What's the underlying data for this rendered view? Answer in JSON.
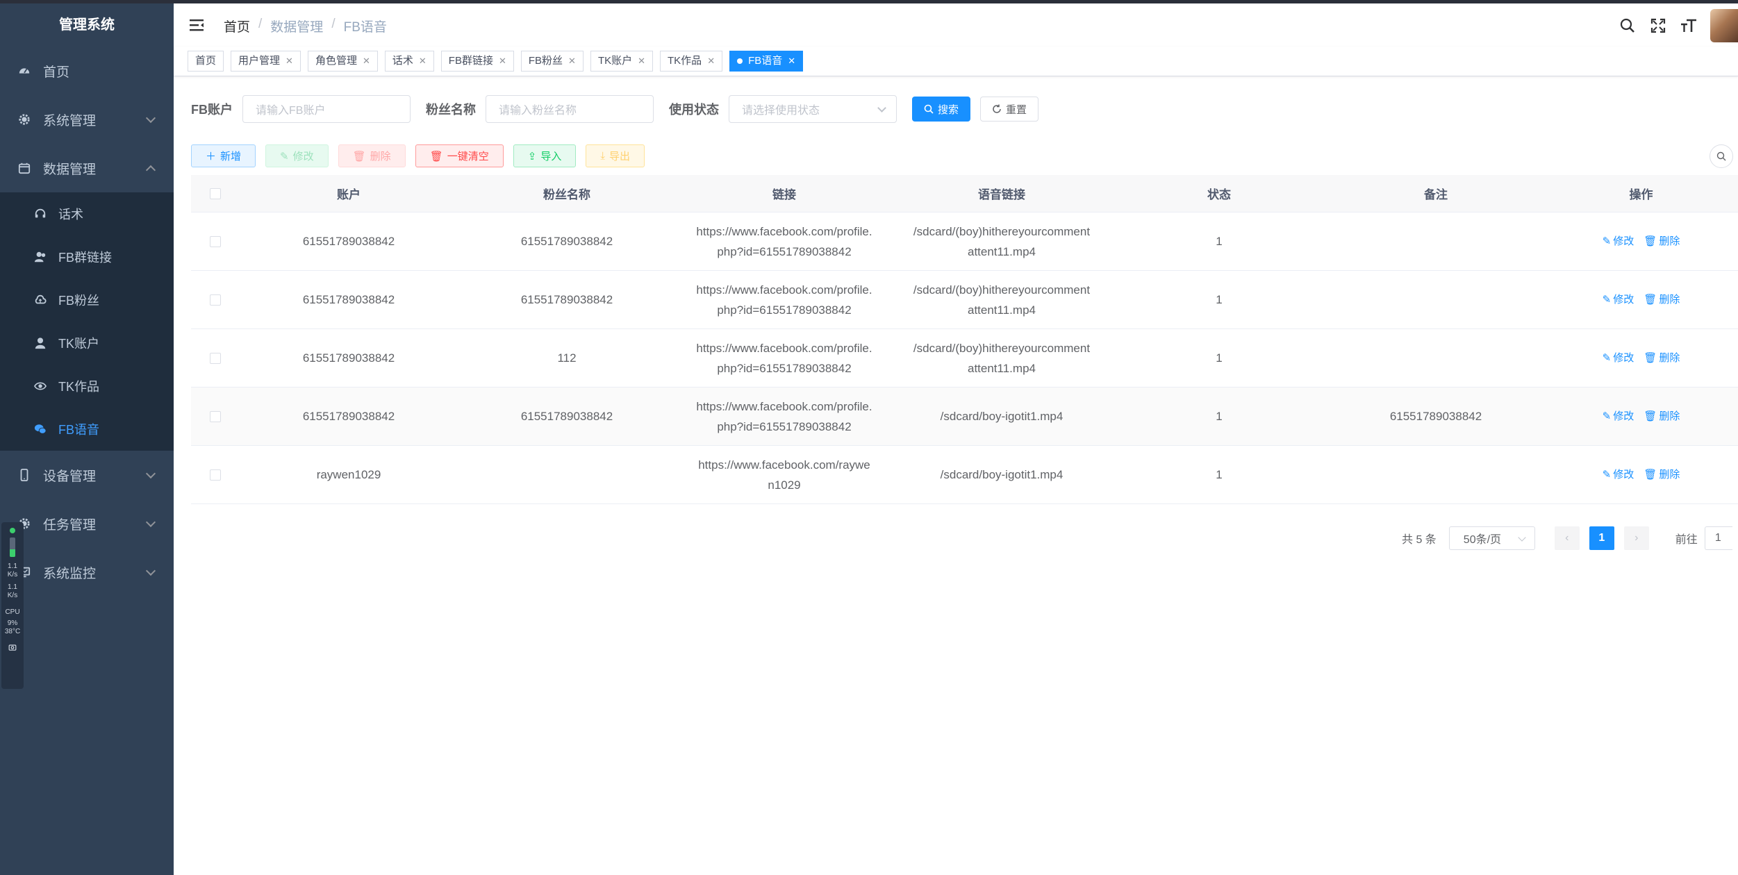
{
  "app": {
    "title": "管理系统"
  },
  "sidebar": {
    "items": [
      {
        "label": "首页",
        "icon": "dashboard-icon"
      },
      {
        "label": "系统管理",
        "icon": "gear-icon"
      },
      {
        "label": "数据管理",
        "icon": "calendar-icon",
        "expanded": true,
        "children": [
          {
            "label": "话术",
            "icon": "headset-icon"
          },
          {
            "label": "FB群链接",
            "icon": "peoples-icon"
          },
          {
            "label": "FB粉丝",
            "icon": "cloud-icon"
          },
          {
            "label": "TK账户",
            "icon": "user-icon"
          },
          {
            "label": "TK作品",
            "icon": "eye-icon"
          },
          {
            "label": "FB语音",
            "icon": "wechat-icon",
            "active": true
          }
        ]
      },
      {
        "label": "设备管理",
        "icon": "phone-icon"
      },
      {
        "label": "任务管理",
        "icon": "gear-icon"
      },
      {
        "label": "系统监控",
        "icon": "monitor-icon"
      }
    ]
  },
  "monitor": {
    "up": "1.1",
    "up_unit": "K/s",
    "down": "1.1",
    "down_unit": "K/s",
    "cpu_label": "CPU",
    "cpu": "9%",
    "temp": "38°C"
  },
  "breadcrumb": {
    "items": [
      "首页",
      "数据管理",
      "FB语音"
    ],
    "separator": "/"
  },
  "tabs": [
    {
      "label": "首页",
      "closable": false
    },
    {
      "label": "用户管理",
      "closable": true
    },
    {
      "label": "角色管理",
      "closable": true
    },
    {
      "label": "话术",
      "closable": true
    },
    {
      "label": "FB群链接",
      "closable": true
    },
    {
      "label": "FB粉丝",
      "closable": true
    },
    {
      "label": "TK账户",
      "closable": true
    },
    {
      "label": "TK作品",
      "closable": true
    },
    {
      "label": "FB语音",
      "closable": true,
      "active": true
    }
  ],
  "search": {
    "account_label": "FB账户",
    "account_placeholder": "请输入FB账户",
    "fan_label": "粉丝名称",
    "fan_placeholder": "请输入粉丝名称",
    "status_label": "使用状态",
    "status_placeholder": "请选择使用状态",
    "search_btn": "搜索",
    "reset_btn": "重置"
  },
  "toolbar": {
    "add": "新增",
    "edit": "修改",
    "delete": "删除",
    "clear": "一键清空",
    "import": "导入",
    "export": "导出"
  },
  "table": {
    "columns": [
      "账户",
      "粉丝名称",
      "链接",
      "语音链接",
      "状态",
      "备注",
      "操作"
    ],
    "rows": [
      {
        "account": "61551789038842",
        "fan": "61551789038842",
        "link": "https://www.facebook.com/profile.php?id=61551789038842",
        "voice": "/sdcard/(boy)hithereyourcommentattent11.mp4",
        "status": "1",
        "remark": ""
      },
      {
        "account": "61551789038842",
        "fan": "61551789038842",
        "link": "https://www.facebook.com/profile.php?id=61551789038842",
        "voice": "/sdcard/(boy)hithereyourcommentattent11.mp4",
        "status": "1",
        "remark": ""
      },
      {
        "account": "61551789038842",
        "fan": "112",
        "link": "https://www.facebook.com/profile.php?id=61551789038842",
        "voice": "/sdcard/(boy)hithereyourcommentattent11.mp4",
        "status": "1",
        "remark": ""
      },
      {
        "account": "61551789038842",
        "fan": "61551789038842",
        "link": "https://www.facebook.com/profile.php?id=61551789038842",
        "voice": "/sdcard/boy-igotit1.mp4",
        "status": "1",
        "remark": "61551789038842"
      },
      {
        "account": "raywen1029",
        "fan": "",
        "link": "https://www.facebook.com/raywen1029",
        "voice": "/sdcard/boy-igotit1.mp4",
        "status": "1",
        "remark": ""
      }
    ],
    "action_edit": "修改",
    "action_delete": "删除"
  },
  "pagination": {
    "total": "共 5 条",
    "page_size": "50条/页",
    "current": "1",
    "goto_label": "前往",
    "goto_value": "1"
  },
  "colors": {
    "sidebar_bg": "#304156",
    "accent": "#1890ff",
    "active_menu": "#409eff"
  }
}
